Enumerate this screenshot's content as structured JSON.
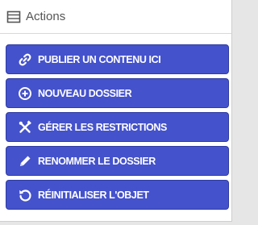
{
  "panel": {
    "title": "Actions",
    "icon": "list-icon"
  },
  "actions": [
    {
      "label": "PUBLIER UN CONTENU ICI",
      "icon": "link-icon"
    },
    {
      "label": "NOUVEAU DOSSIER",
      "icon": "plus-circle-icon"
    },
    {
      "label": "GÉRER LES RESTRICTIONS",
      "icon": "tools-icon"
    },
    {
      "label": "RENOMMER LE DOSSIER",
      "icon": "pencil-icon"
    },
    {
      "label": "RÉINITIALISER L'OBJET",
      "icon": "reset-icon"
    }
  ],
  "colors": {
    "button_bg": "#4452cc",
    "button_border": "#2f3ba4",
    "header_text": "#555555"
  }
}
